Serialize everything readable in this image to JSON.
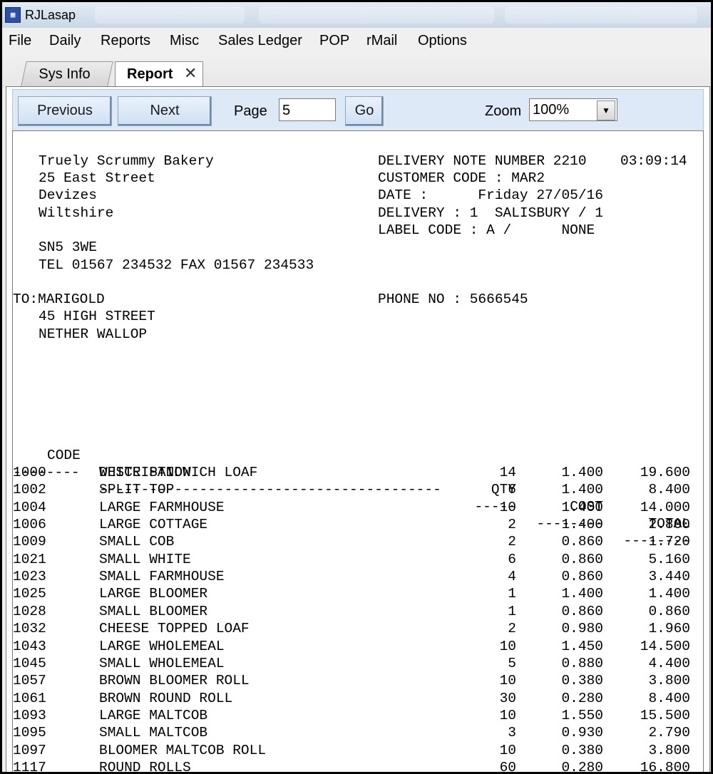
{
  "window": {
    "title": "RJLasap",
    "icon_name": "app-icon"
  },
  "menu": [
    "File",
    "Daily",
    "Reports",
    "Misc",
    "Sales Ledger",
    "POP",
    "rMail",
    "Options"
  ],
  "tabs": {
    "sys_info": "Sys Info",
    "report": "Report"
  },
  "toolbar": {
    "previous": "Previous",
    "next": "Next",
    "page_label": "Page",
    "page_value": "5",
    "go": "Go",
    "zoom_label": "Zoom",
    "zoom_value": "100%"
  },
  "report": {
    "company": {
      "name": "Truely Scrummy Bakery",
      "street": "25 East Street",
      "town": "Devizes",
      "county": "Wiltshire",
      "postcode": "SN5 3WE",
      "contact": "TEL 01567 234532 FAX 01567 234533"
    },
    "header": {
      "delivery_note": "DELIVERY NOTE NUMBER 2210",
      "time": "03:09:14",
      "customer_code": "CUSTOMER CODE : MAR2",
      "date": "DATE :      Friday 27/05/16",
      "delivery": "DELIVERY : 1  SALISBURY / 1",
      "label_code": "LABEL CODE : A /      NONE"
    },
    "to": {
      "name": "TO:MARIGOLD",
      "street": "45 HIGH STREET",
      "town": "NETHER WALLOP",
      "phone": "PHONE NO : 5666545"
    },
    "columns": {
      "code": "CODE",
      "description": "DESCRIPTION",
      "qty": "QTY",
      "cost": "COST",
      "total": "TOTAL"
    },
    "rules": {
      "code": "--------",
      "description": "-----------------------------------------",
      "qty": "-----",
      "cost": "--------",
      "total": "--------"
    },
    "rows": [
      {
        "code": "1000",
        "description": "WHITE SANDWICH LOAF",
        "qty": "14",
        "cost": "1.400",
        "total": "19.600"
      },
      {
        "code": "1002",
        "description": "SPLIT TOP",
        "qty": "6",
        "cost": "1.400",
        "total": "8.400"
      },
      {
        "code": "1004",
        "description": "LARGE FARMHOUSE",
        "qty": "10",
        "cost": "1.400",
        "total": "14.000"
      },
      {
        "code": "1006",
        "description": "LARGE COTTAGE",
        "qty": "2",
        "cost": "1.400",
        "total": "2.800"
      },
      {
        "code": "1009",
        "description": "SMALL COB",
        "qty": "2",
        "cost": "0.860",
        "total": "1.720"
      },
      {
        "code": "1021",
        "description": "SMALL WHITE",
        "qty": "6",
        "cost": "0.860",
        "total": "5.160"
      },
      {
        "code": "1023",
        "description": "SMALL FARMHOUSE",
        "qty": "4",
        "cost": "0.860",
        "total": "3.440"
      },
      {
        "code": "1025",
        "description": "LARGE BLOOMER",
        "qty": "1",
        "cost": "1.400",
        "total": "1.400"
      },
      {
        "code": "1028",
        "description": "SMALL BLOOMER",
        "qty": "1",
        "cost": "0.860",
        "total": "0.860"
      },
      {
        "code": "1032",
        "description": "CHEESE TOPPED LOAF",
        "qty": "2",
        "cost": "0.980",
        "total": "1.960"
      },
      {
        "code": "1043",
        "description": "LARGE WHOLEMEAL",
        "qty": "10",
        "cost": "1.450",
        "total": "14.500"
      },
      {
        "code": "1045",
        "description": "SMALL WHOLEMEAL",
        "qty": "5",
        "cost": "0.880",
        "total": "4.400"
      },
      {
        "code": "1057",
        "description": "BROWN BLOOMER ROLL",
        "qty": "10",
        "cost": "0.380",
        "total": "3.800"
      },
      {
        "code": "1061",
        "description": "BROWN ROUND ROLL",
        "qty": "30",
        "cost": "0.280",
        "total": "8.400"
      },
      {
        "code": "1093",
        "description": "LARGE MALTCOB",
        "qty": "10",
        "cost": "1.550",
        "total": "15.500"
      },
      {
        "code": "1095",
        "description": "SMALL MALTCOB",
        "qty": "3",
        "cost": "0.930",
        "total": "2.790"
      },
      {
        "code": "1097",
        "description": "BLOOMER MALTCOB ROLL",
        "qty": "10",
        "cost": "0.380",
        "total": "3.800"
      },
      {
        "code": "1117",
        "description": "ROUND ROLLS",
        "qty": "60",
        "cost": "0.280",
        "total": "16.800"
      }
    ]
  }
}
